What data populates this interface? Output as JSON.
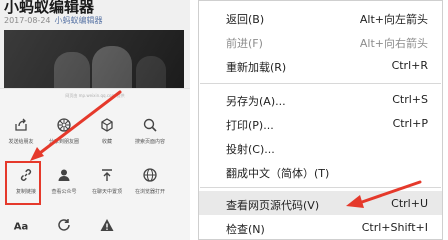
{
  "article": {
    "title": "小蚂蚁编辑器",
    "date": "2017-08-24",
    "author": "小蚂蚁编辑器"
  },
  "share_sheet": {
    "caption": "网页由 mp.weixin.qq.com 提供",
    "actions": [
      {
        "label": "发送给朋友",
        "icon": "share-icon"
      },
      {
        "label": "分享到朋友圈",
        "icon": "moments-icon"
      },
      {
        "label": "收藏",
        "icon": "favorite-cube-icon"
      },
      {
        "label": "搜索页面内容",
        "icon": "search-icon"
      },
      {
        "label": "复制链接",
        "icon": "link-icon"
      },
      {
        "label": "查看公众号",
        "icon": "person-icon"
      },
      {
        "label": "在聊天中置顶",
        "icon": "pin-top-icon"
      },
      {
        "label": "在浏览器打开",
        "icon": "globe-icon"
      },
      {
        "label": "Aa",
        "icon": "font-icon"
      },
      {
        "label": "",
        "icon": "refresh-icon"
      },
      {
        "label": "",
        "icon": "warning-icon"
      }
    ]
  },
  "context_menu": {
    "items": [
      {
        "label": "返回(B)",
        "shortcut": "Alt+向左箭头",
        "enabled": true
      },
      {
        "label": "前进(F)",
        "shortcut": "Alt+向右箭头",
        "enabled": false
      },
      {
        "label": "重新加载(R)",
        "shortcut": "Ctrl+R",
        "enabled": true
      },
      {
        "label": "另存为(A)...",
        "shortcut": "Ctrl+S",
        "enabled": true
      },
      {
        "label": "打印(P)...",
        "shortcut": "Ctrl+P",
        "enabled": true
      },
      {
        "label": "投射(C)...",
        "shortcut": "",
        "enabled": true
      },
      {
        "label": "翻成中文（简体）(T)",
        "shortcut": "",
        "enabled": true
      },
      {
        "label": "查看网页源代码(V)",
        "shortcut": "Ctrl+U",
        "enabled": true,
        "highlighted": true
      },
      {
        "label": "检查(N)",
        "shortcut": "Ctrl+Shift+I",
        "enabled": true
      }
    ]
  },
  "colors": {
    "annotation_red": "#e5392b",
    "highlight_bg": "#e9e9e9",
    "disabled_text": "#8c8c8c"
  }
}
